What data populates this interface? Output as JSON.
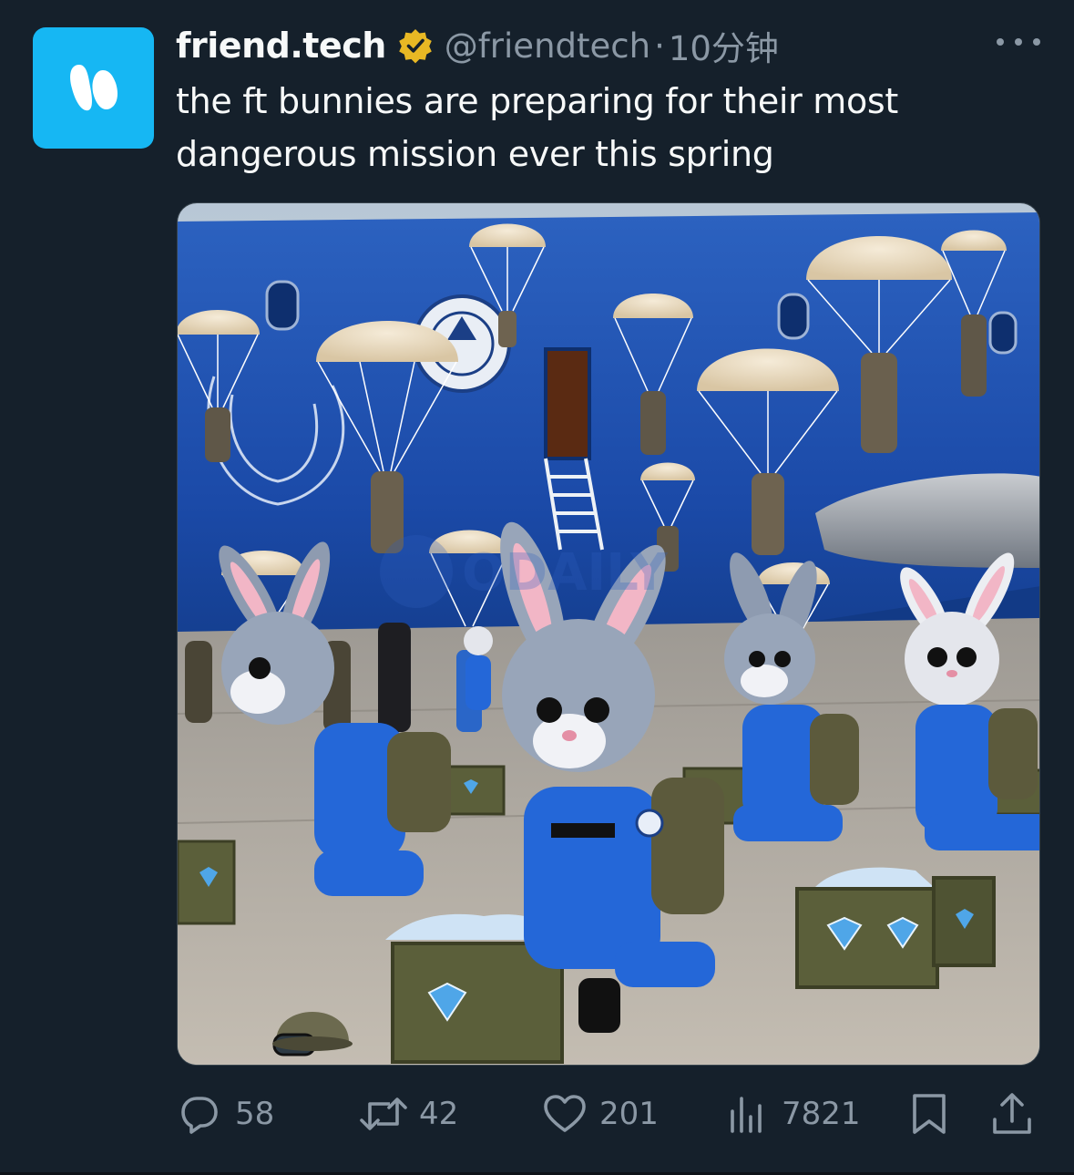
{
  "author": {
    "display_name": "friend.tech",
    "handle": "@friendtech",
    "separator": "·",
    "time": "10分钟",
    "verified": true,
    "avatar_color": "#16b7f3",
    "verified_badge_color": "#e8b824"
  },
  "tweet": {
    "text_line_1": "the ft bunnies are preparing for their most",
    "text_line_2": "dangerous mission ever this spring"
  },
  "media": {
    "type": "image",
    "watermark": "ODAILY"
  },
  "actions": {
    "reply_count": "58",
    "retweet_count": "42",
    "like_count": "201",
    "view_count": "7821"
  },
  "icons": {
    "more": "more-horizontal-icon",
    "reply": "reply-icon",
    "retweet": "retweet-icon",
    "like": "heart-icon",
    "views": "views-chart-icon",
    "bookmark": "bookmark-icon",
    "share": "share-icon"
  },
  "colors": {
    "background": "#15202b",
    "text_primary": "#f7f9f9",
    "text_secondary": "#8b98a5"
  }
}
